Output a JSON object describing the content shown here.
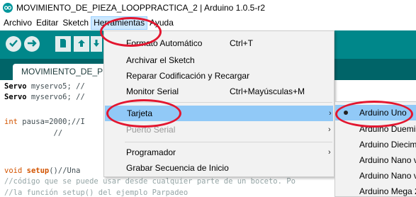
{
  "window": {
    "title": "MOVIMIENTO_DE_PIEZA_LOOPPRACTICA_2 | Arduino 1.0.5-r2"
  },
  "menubar": {
    "items": [
      "Archivo",
      "Editar",
      "Sketch",
      "Herramientas",
      "Ayuda"
    ],
    "active": "Herramientas"
  },
  "toolbar": {
    "buttons": [
      "check-icon",
      "arrow-right-icon",
      "new-file-icon",
      "open-icon",
      "save-icon"
    ]
  },
  "tab": {
    "label": "MOVIMIENTO_DE_P"
  },
  "editor": {
    "lines": [
      {
        "type": "Servo",
        "rest": " myservo5; //"
      },
      {
        "type": "Servo",
        "rest": " myservo6; //"
      },
      {
        "kw": "int",
        "rest": " pausa=2000;//I"
      },
      {
        "rest": "           //"
      },
      {
        "kw": "void",
        "func": "setup",
        "rest": "()//Una"
      },
      {
        "comment": "//código que se puede usar desde cualquier parte de un boceto. Po"
      },
      {
        "comment": "//la función setup() del ejemplo Parpadeo"
      }
    ]
  },
  "herramientas_menu": {
    "items": [
      {
        "label": "Formato Automático",
        "shortcut": "Ctrl+T"
      },
      {
        "label": "Archivar el Sketch",
        "shortcut": ""
      },
      {
        "label": "Reparar Codificación y Recargar",
        "shortcut": ""
      },
      {
        "label": "Monitor Serial",
        "shortcut": "Ctrl+Mayúsculas+M"
      },
      {
        "label": "Tarjeta",
        "shortcut": "",
        "submenu": true,
        "highlighted": true
      },
      {
        "label": "Puerto Serial",
        "shortcut": "",
        "submenu": true,
        "disabled": true
      },
      {
        "label": "Programador",
        "shortcut": "",
        "submenu": true
      },
      {
        "label": "Grabar Secuencia de Inicio",
        "shortcut": ""
      }
    ],
    "submenu_arrow": "›"
  },
  "tarjeta_submenu": {
    "items": [
      {
        "label": "Arduino Uno",
        "selected": true,
        "highlighted": true
      },
      {
        "label": "Arduino Duemi"
      },
      {
        "label": "Arduino Diecim"
      },
      {
        "label": "Arduino Nano v"
      },
      {
        "label": "Arduino Nano v"
      },
      {
        "label": "Arduino Mega 2"
      }
    ]
  },
  "colors": {
    "toolbar": "#00878a",
    "tabstrip": "#006468",
    "highlight": "#91c9f7",
    "annotation": "#e3162f"
  }
}
